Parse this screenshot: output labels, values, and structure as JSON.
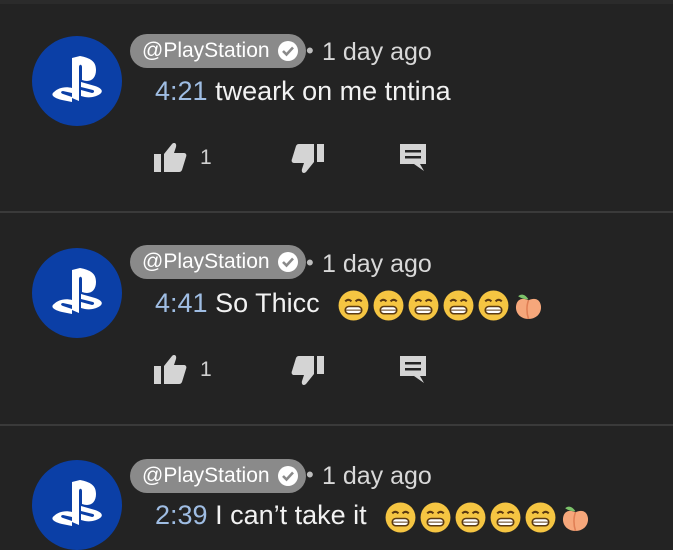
{
  "comments": [
    {
      "channel": "@PlayStation",
      "age": "1 day ago",
      "timestamp": "4:21",
      "text": "tweark on me tntina",
      "emoji": [],
      "likes": "1"
    },
    {
      "channel": "@PlayStation",
      "age": "1 day ago",
      "timestamp": "4:41",
      "text": "So Thicc",
      "emoji": [
        "grimace",
        "grimace",
        "grimace",
        "grimace",
        "grimace",
        "peach"
      ],
      "likes": "1"
    },
    {
      "channel": "@PlayStation",
      "age": "1 day ago",
      "timestamp": "2:39",
      "text": "I can’t take it",
      "emoji": [
        "grimace",
        "grimace",
        "grimace",
        "grimace",
        "grimace",
        "peach"
      ],
      "likes": ""
    }
  ],
  "separator": "•",
  "colors": {
    "background": "#232323",
    "avatar": "#0b3fa6",
    "chip": "#8a8a8a",
    "timestamp": "#9fbde3",
    "emoji_face": "#f5c542",
    "emoji_peach": "#f6a77b"
  },
  "icons": {
    "avatar": "playstation-logo",
    "verified": "verified-check-icon",
    "like": "thumbs-up-icon",
    "dislike": "thumbs-down-icon",
    "reply": "reply-comment-icon"
  }
}
